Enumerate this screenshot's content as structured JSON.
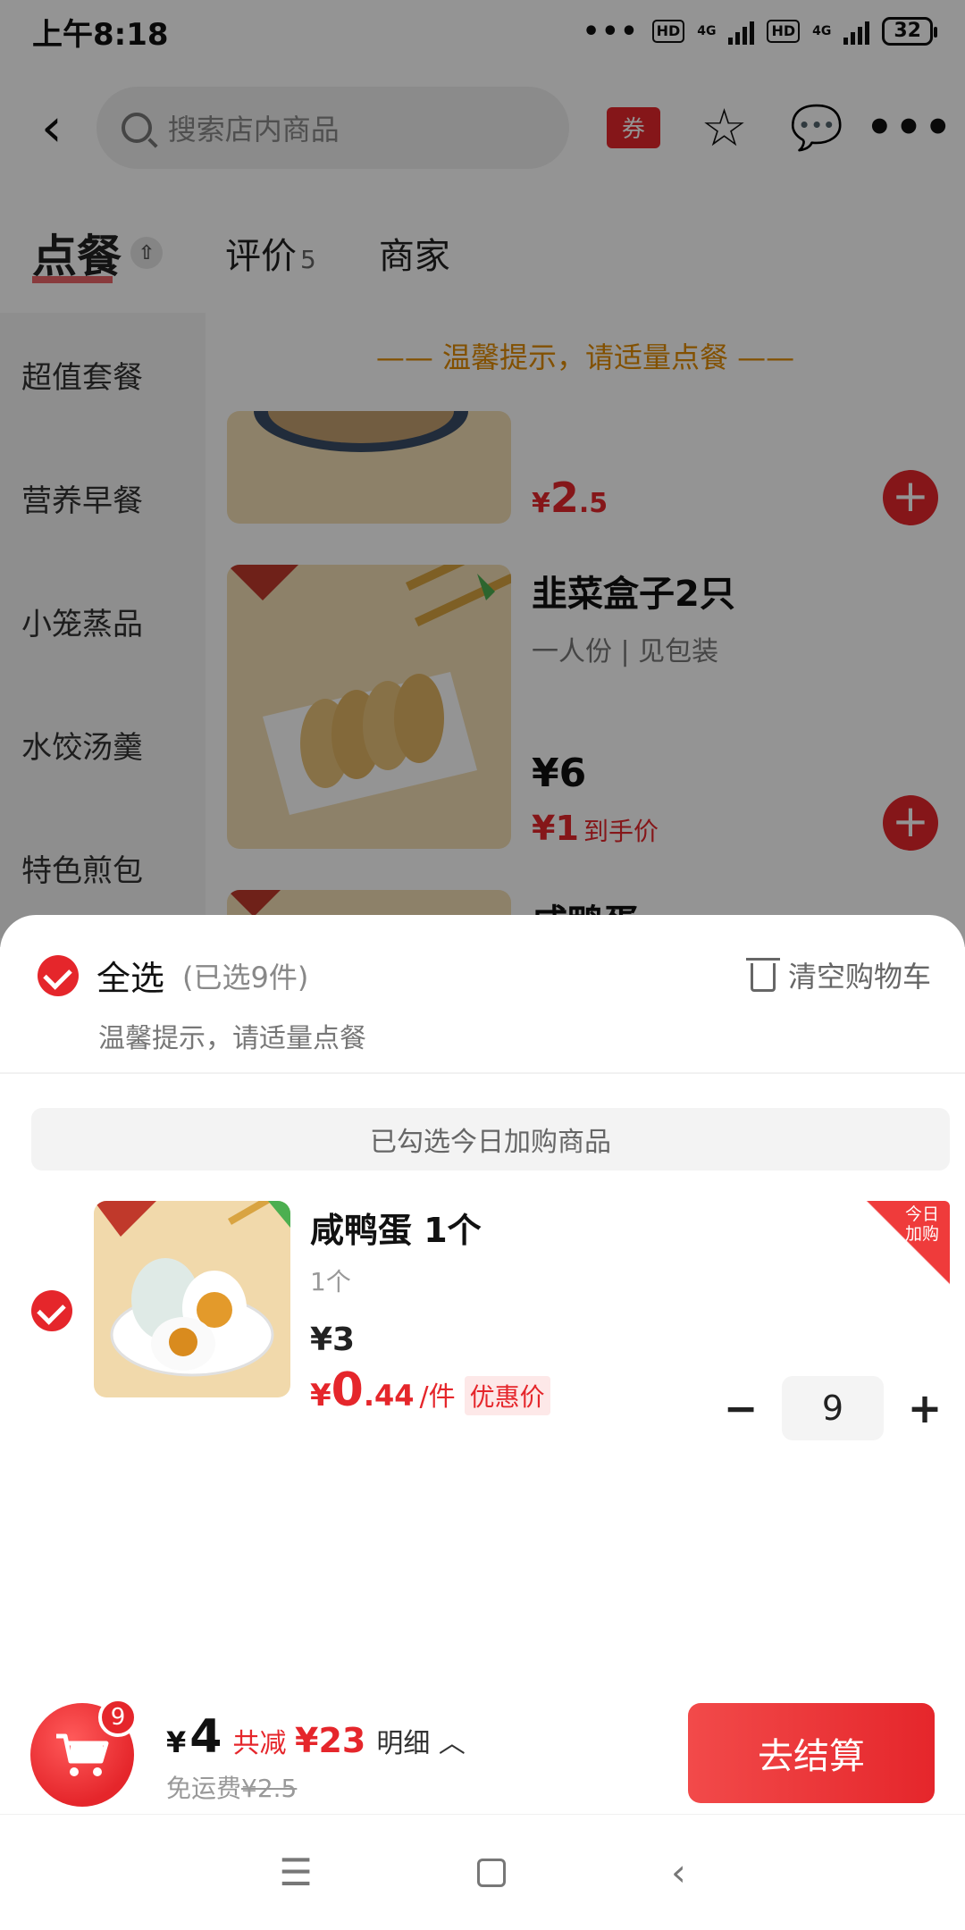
{
  "status_bar": {
    "time": "上午8:18",
    "dots": "•••",
    "hd": "HD",
    "net": "4G",
    "battery": "32"
  },
  "header": {
    "search_placeholder": "搜索店内商品",
    "coupon_label": "券"
  },
  "tabs": [
    {
      "label": "点餐"
    },
    {
      "label": "评价",
      "count": "5"
    },
    {
      "label": "商家"
    }
  ],
  "sidebar": {
    "items": [
      {
        "label": "超值套餐"
      },
      {
        "label": "营养早餐"
      },
      {
        "label": "小笼蒸品"
      },
      {
        "label": "水饺汤羹"
      },
      {
        "label": "特色煎包"
      }
    ]
  },
  "content": {
    "tip": "—— 温馨提示，请适量点餐 ——",
    "products": [
      {
        "price_yen": "¥",
        "price_int": "2",
        "price_dec": ".5"
      },
      {
        "name": "韭菜盒子2只",
        "sub": "一人份 | 见包装",
        "price": "¥6",
        "deal_price": "¥1",
        "deal_label": "到手价"
      },
      {
        "name": "咸鸭蛋"
      }
    ]
  },
  "cart": {
    "select_all": "全选",
    "selected_count": "(已选9件)",
    "clear_cart": "清空购物车",
    "tip": "温馨提示，请适量点餐",
    "section_label": "已勾选今日加购商品",
    "item": {
      "name": "咸鸭蛋 1个",
      "spec": "1个",
      "price": "¥3",
      "deal_yen": "¥",
      "deal_int": "0",
      "deal_dec": ".44",
      "deal_unit": "/件",
      "deal_tag": "优惠价",
      "badge": "今日加购",
      "quantity": "9",
      "minus": "−",
      "plus": "+"
    }
  },
  "bottom_bar": {
    "cart_count": "9",
    "total_yen": "¥",
    "total": "4",
    "saved_label": "共减",
    "saved_amount": "¥23",
    "detail_label": "明细",
    "delivery_label": "免运费",
    "delivery_original": "¥2.5",
    "checkout_label": "去结算"
  },
  "colors": {
    "accent": "#e5262b",
    "tip": "#e08a00"
  }
}
